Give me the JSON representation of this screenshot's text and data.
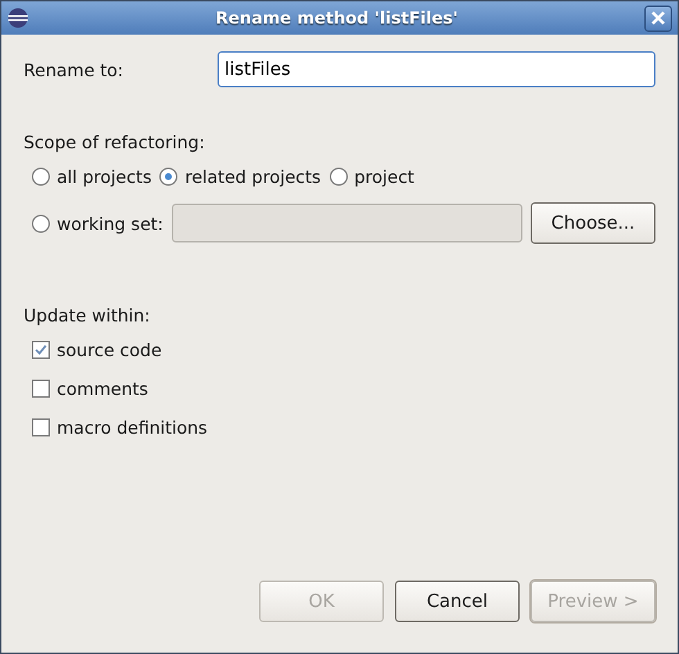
{
  "window": {
    "title": "Rename method 'listFiles'"
  },
  "rename": {
    "label": "Rename to:",
    "value": "listFiles"
  },
  "scope": {
    "label": "Scope of refactoring:",
    "options": [
      {
        "label": "all projects",
        "selected": false
      },
      {
        "label": "related projects",
        "selected": true
      },
      {
        "label": "project",
        "selected": false
      }
    ],
    "working_set": {
      "label": "working set:",
      "selected": false,
      "disabled": true,
      "button": "Choose..."
    }
  },
  "update": {
    "label": "Update within:",
    "options": [
      {
        "label": "source code",
        "checked": true
      },
      {
        "label": "comments",
        "checked": false
      },
      {
        "label": "macro definitions",
        "checked": false
      }
    ]
  },
  "buttons": [
    {
      "label": "OK",
      "disabled": true,
      "default": false
    },
    {
      "label": "Cancel",
      "disabled": false,
      "default": false
    },
    {
      "label": "Preview >",
      "disabled": true,
      "default": true
    }
  ]
}
